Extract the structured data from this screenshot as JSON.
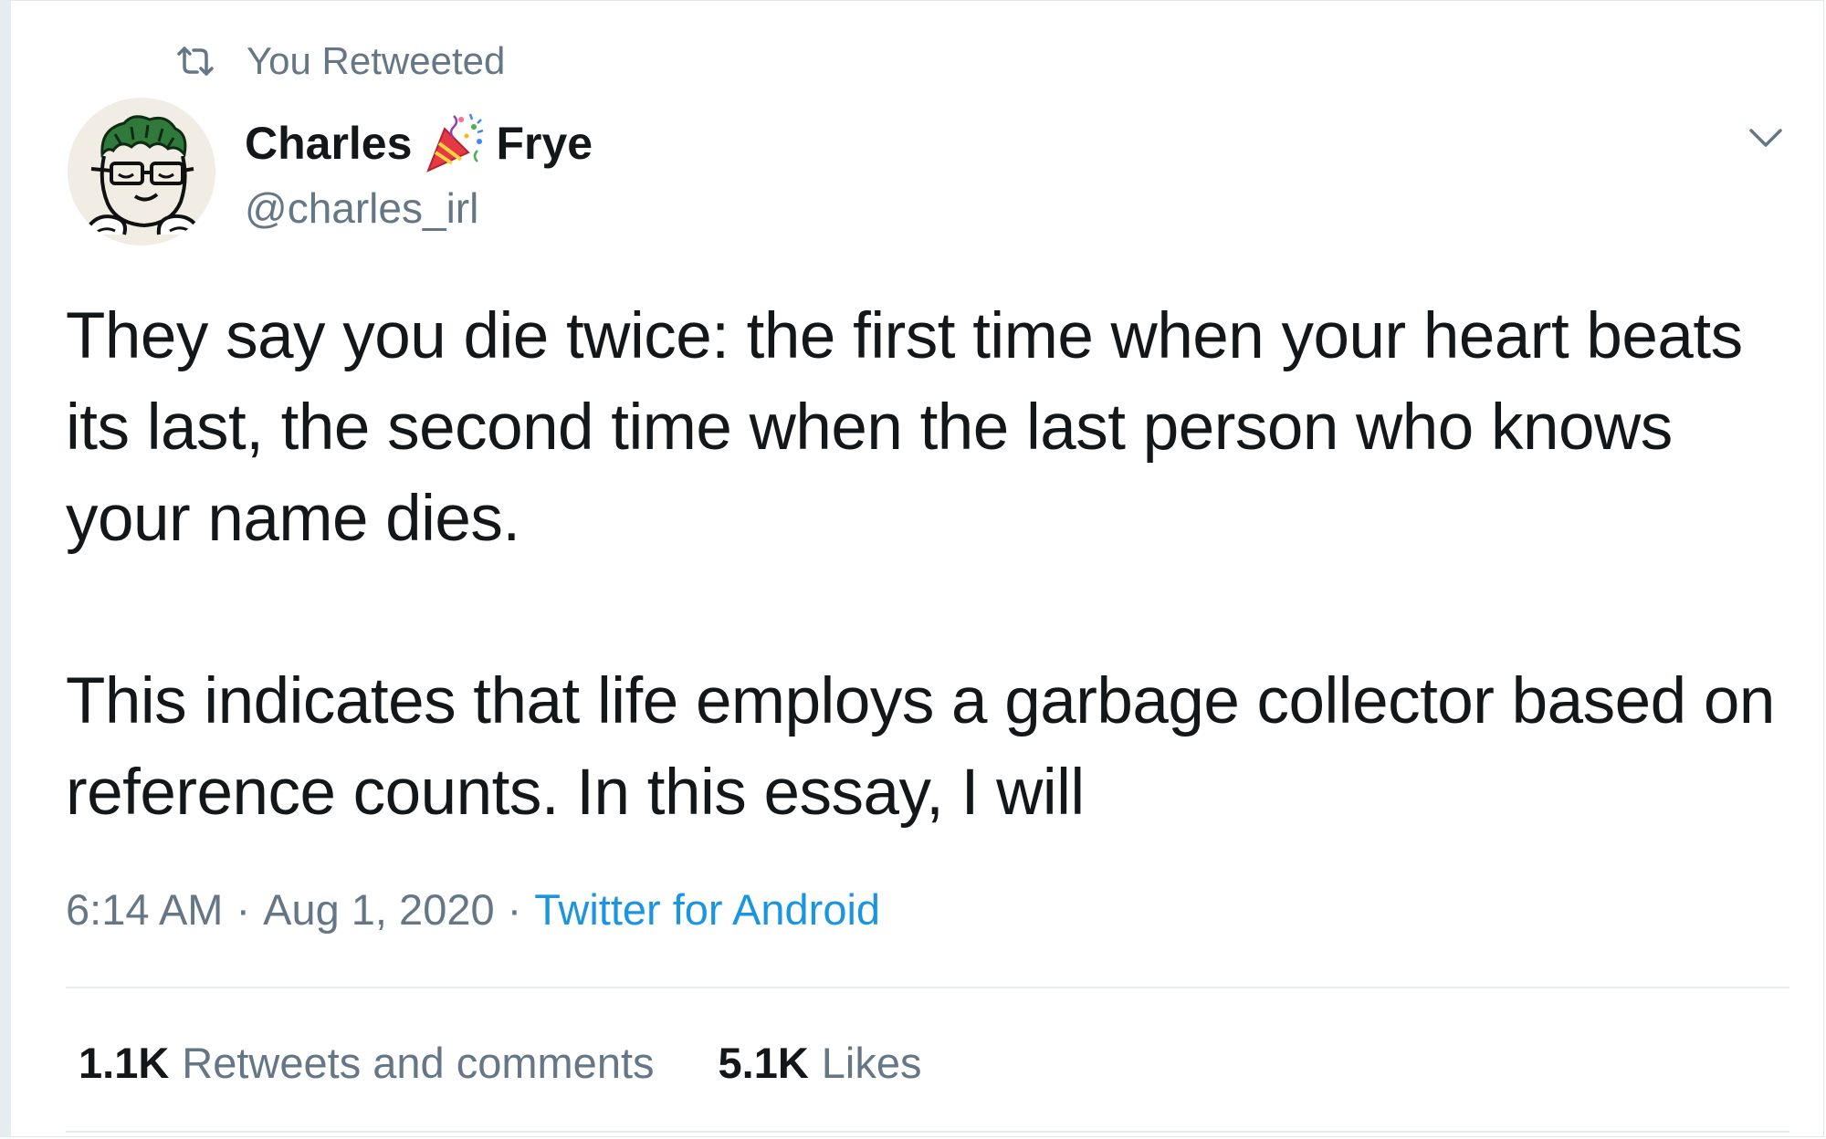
{
  "retweet_context": {
    "label": "You Retweeted",
    "icon": "retweet-icon"
  },
  "author": {
    "name_first": "Charles",
    "name_emoji": "party-popper-icon",
    "name_last": "Frye",
    "handle": "@charles_irl",
    "avatar": "hand-drawn-avatar"
  },
  "tweet": {
    "paragraphs": [
      "They say you die twice: the first time when your heart beats its last, the second time when the last person who knows your name dies.",
      "This indicates that life employs a garbage collector based on reference counts. In this essay, I will"
    ],
    "time": "6:14 AM",
    "separator": "·",
    "date": "Aug 1, 2020",
    "source": "Twitter for Android"
  },
  "stats": {
    "retweets_count": "1.1K",
    "retweets_label": "Retweets and comments",
    "likes_count": "5.1K",
    "likes_label": "Likes"
  },
  "colors": {
    "text_primary": "#14171a",
    "text_secondary": "#657786",
    "link": "#1b95e0",
    "divider": "#e6ecf0"
  }
}
